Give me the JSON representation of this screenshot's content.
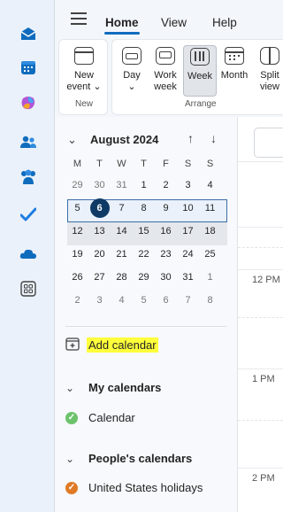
{
  "rail": {
    "icons": [
      "mail-icon",
      "calendar-icon",
      "copilot-icon",
      "people-icon",
      "teams-icon",
      "todo-icon",
      "onedrive-icon",
      "apps-icon"
    ]
  },
  "header": {
    "tabs": [
      {
        "label": "Home"
      },
      {
        "label": "View"
      },
      {
        "label": "Help"
      }
    ]
  },
  "ribbon": {
    "new_event": {
      "line1": "New",
      "line2": "event"
    },
    "new_group_label": "New",
    "day": {
      "line1": "Day"
    },
    "work_week": {
      "line1": "Work",
      "line2": "week"
    },
    "week": {
      "line1": "Week"
    },
    "month": {
      "line1": "Month"
    },
    "split_view": {
      "line1": "Split",
      "line2": "view"
    },
    "arrange_group_label": "Arrange"
  },
  "minical": {
    "month_label": "August 2024",
    "dow": [
      "M",
      "T",
      "W",
      "T",
      "F",
      "S",
      "S"
    ],
    "weeks": [
      [
        "29",
        "30",
        "31",
        "1",
        "2",
        "3",
        "4"
      ],
      [
        "5",
        "6",
        "7",
        "8",
        "9",
        "10",
        "11"
      ],
      [
        "12",
        "13",
        "14",
        "15",
        "16",
        "17",
        "18"
      ],
      [
        "19",
        "20",
        "21",
        "22",
        "23",
        "24",
        "25"
      ],
      [
        "26",
        "27",
        "28",
        "29",
        "30",
        "31",
        "1"
      ],
      [
        "2",
        "3",
        "4",
        "5",
        "6",
        "7",
        "8"
      ]
    ]
  },
  "sidebar": {
    "add_calendar": "Add calendar",
    "my_calendars": "My calendars",
    "calendar_item": "Calendar",
    "peoples_calendars": "People's calendars",
    "holidays_item": "United States holidays"
  },
  "main": {
    "times": [
      "12 PM",
      "1 PM",
      "2 PM"
    ]
  },
  "colors": {
    "accent": "#0f6cbd",
    "today": "#0f3a66",
    "highlight": "#ffff3b",
    "calendar_green": "#6cc36c",
    "holiday_orange": "#e07a24"
  }
}
